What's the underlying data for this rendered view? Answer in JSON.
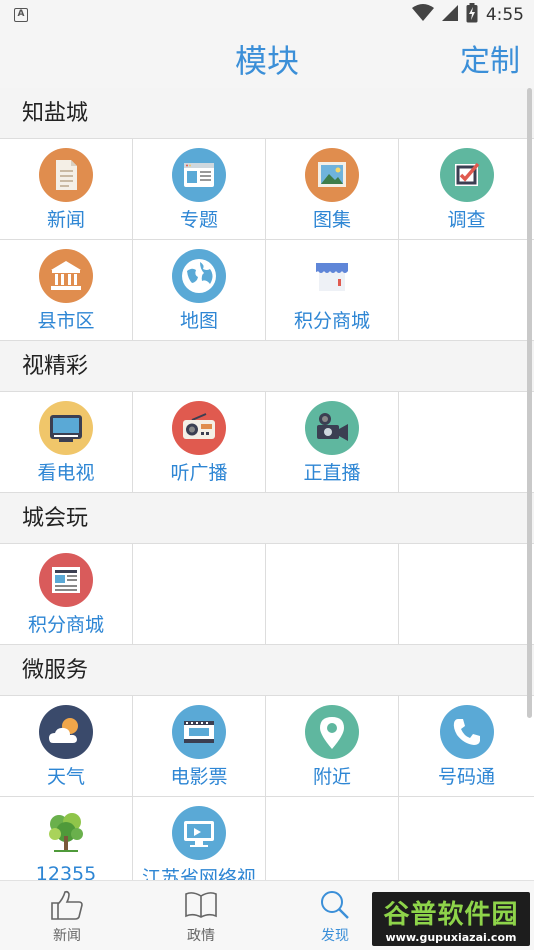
{
  "status_bar": {
    "left_badge": "A",
    "time": "4:55"
  },
  "app_bar": {
    "title": "模块",
    "action": "定制"
  },
  "sections": [
    {
      "title": "知盐城",
      "items": [
        {
          "label": "新闻",
          "icon": "document-icon",
          "color": "#e08d4e"
        },
        {
          "label": "专题",
          "icon": "browser-window-icon",
          "color": "#5aa9d6"
        },
        {
          "label": "图集",
          "icon": "picture-icon",
          "color": "#e08d4e"
        },
        {
          "label": "调查",
          "icon": "checkbox-icon",
          "color": "#5fb79f"
        },
        {
          "label": "县市区",
          "icon": "building-icon",
          "color": "#e08d4e"
        },
        {
          "label": "地图",
          "icon": "globe-icon",
          "color": "#5aa9d6"
        },
        {
          "label": "积分商城",
          "icon": "store-icon",
          "color": "none"
        }
      ]
    },
    {
      "title": "视精彩",
      "items": [
        {
          "label": "看电视",
          "icon": "tv-icon",
          "color": "#f0c66a"
        },
        {
          "label": "听广播",
          "icon": "radio-icon",
          "color": "#e05a4f"
        },
        {
          "label": "正直播",
          "icon": "video-camera-icon",
          "color": "#5fb79f"
        }
      ]
    },
    {
      "title": "城会玩",
      "items": [
        {
          "label": "积分商城",
          "icon": "newspaper-icon",
          "color": "#d95b5b"
        }
      ]
    },
    {
      "title": "微服务",
      "items": [
        {
          "label": "天气",
          "icon": "weather-icon",
          "color": "#3a4a6b"
        },
        {
          "label": "电影票",
          "icon": "film-icon",
          "color": "#5aa9d6"
        },
        {
          "label": "附近",
          "icon": "location-pin-icon",
          "color": "#5fb79f"
        },
        {
          "label": "号码通",
          "icon": "phone-icon",
          "color": "#5aa9d6"
        },
        {
          "label": "12355",
          "icon": "tree-logo-icon",
          "color": "none"
        },
        {
          "label": "江苏省网络视",
          "icon": "monitor-icon",
          "color": "#5aa9d6"
        }
      ]
    }
  ],
  "bottom_nav": [
    {
      "label": "新闻",
      "icon": "thumbs-up-icon",
      "active": false
    },
    {
      "label": "政情",
      "icon": "book-icon",
      "active": false
    },
    {
      "label": "发现",
      "icon": "search-icon",
      "active": true
    }
  ],
  "watermark": {
    "top": "谷普软件园",
    "bottom": "www.gupuxiazai.com"
  }
}
